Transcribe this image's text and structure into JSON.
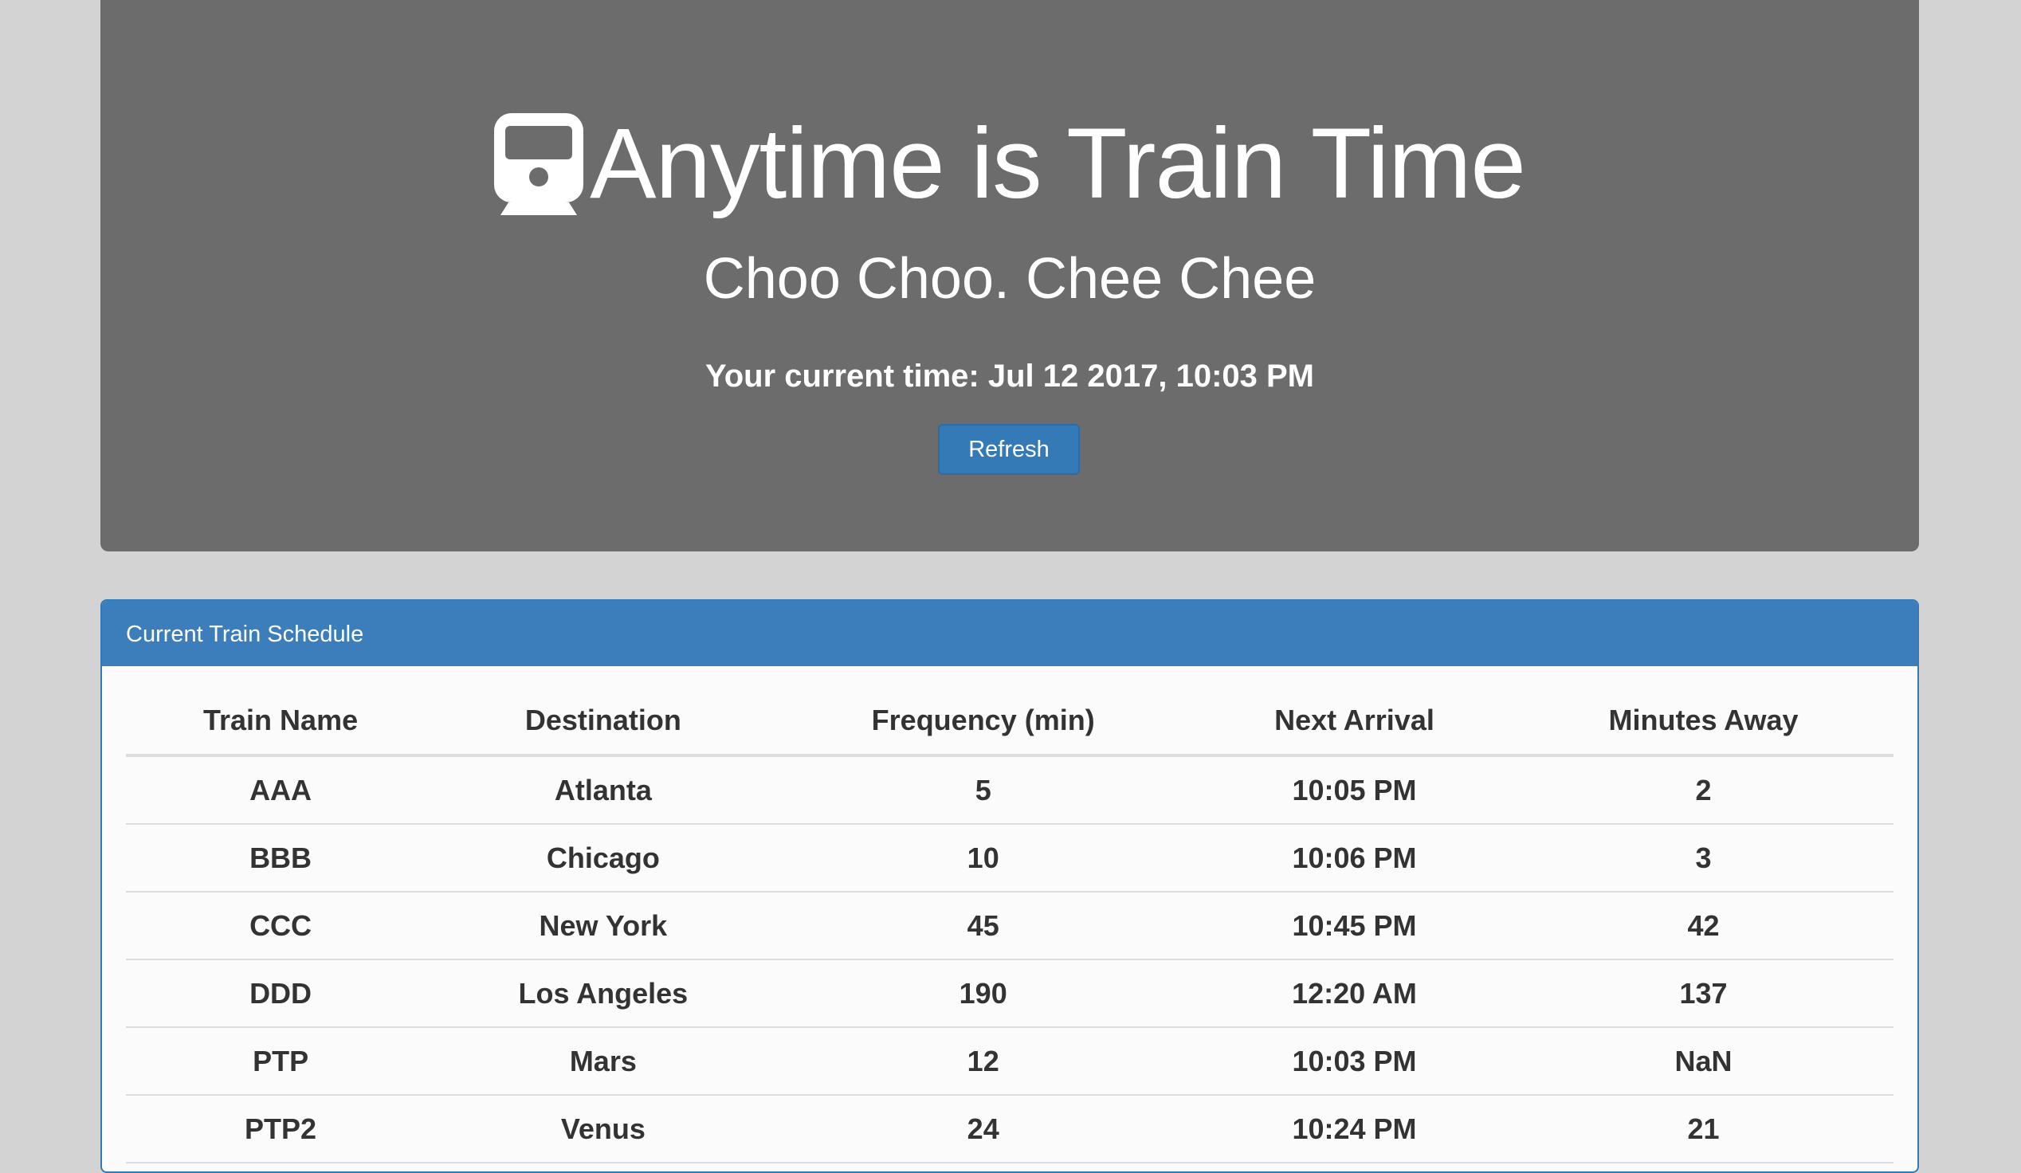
{
  "header": {
    "icon": "train-icon",
    "title": "Anytime is Train Time",
    "subtitle": "Choo Choo. Chee Chee",
    "current_time": "Your current time: Jul 12 2017, 10:03 PM",
    "refresh_label": "Refresh"
  },
  "panel": {
    "heading": "Current Train Schedule",
    "columns": [
      "Train Name",
      "Destination",
      "Frequency (min)",
      "Next Arrival",
      "Minutes Away"
    ],
    "rows": [
      [
        "AAA",
        "Atlanta",
        "5",
        "10:05 PM",
        "2"
      ],
      [
        "BBB",
        "Chicago",
        "10",
        "10:06 PM",
        "3"
      ],
      [
        "CCC",
        "New York",
        "45",
        "10:45 PM",
        "42"
      ],
      [
        "DDD",
        "Los Angeles",
        "190",
        "12:20 AM",
        "137"
      ],
      [
        "PTP",
        "Mars",
        "12",
        "10:03 PM",
        "NaN"
      ],
      [
        "PTP2",
        "Venus",
        "24",
        "10:24 PM",
        "21"
      ]
    ]
  },
  "colors": {
    "background": "#d3d3d3",
    "jumbotron": "#6c6c6c",
    "primary": "#337ab7",
    "text": "#333333"
  }
}
